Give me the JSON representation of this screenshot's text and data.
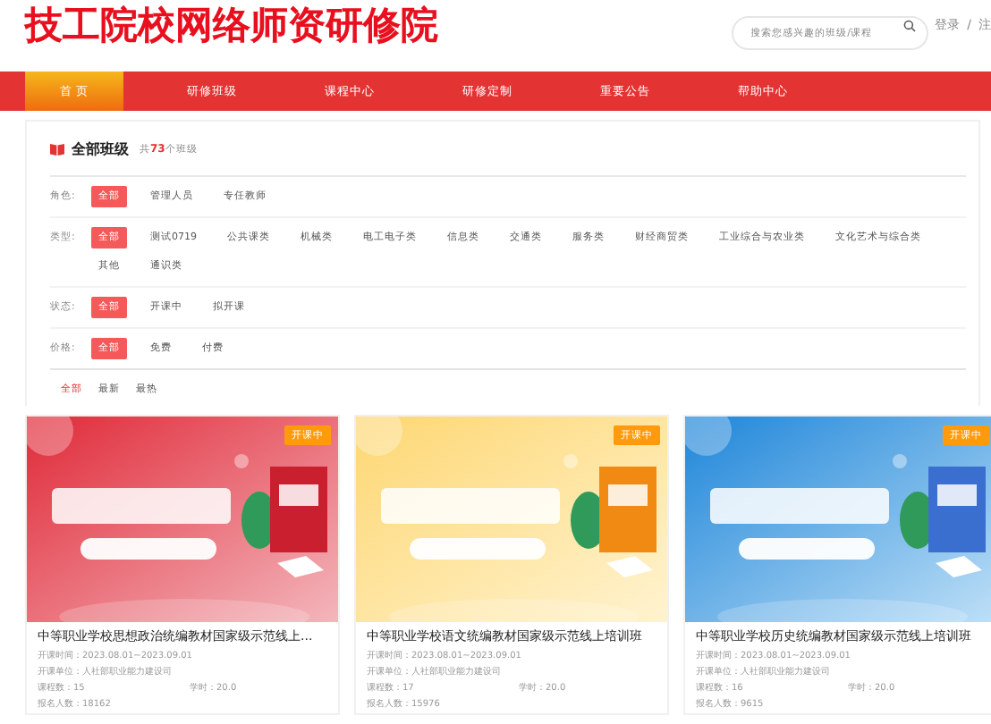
{
  "site": {
    "title": "技工院校网络师资研修院",
    "search_placeholder": "搜索您感兴趣的班级/课程",
    "login": "登录",
    "separator": "/",
    "register": "注"
  },
  "nav": [
    {
      "label": "首 页",
      "selected": true
    },
    {
      "label": "研修班级",
      "selected": false
    },
    {
      "label": "课程中心",
      "selected": false
    },
    {
      "label": "研修定制",
      "selected": false
    },
    {
      "label": "重要公告",
      "selected": false
    },
    {
      "label": "帮助中心",
      "selected": false
    }
  ],
  "filter": {
    "title": "全部班级",
    "count_prefix": "共",
    "count": "73",
    "count_suffix": "个班级",
    "groups": [
      {
        "label": "角色:",
        "options": [
          {
            "label": "全部",
            "selected": true
          },
          {
            "label": "管理人员",
            "selected": false
          },
          {
            "label": "专任教师",
            "selected": false
          }
        ]
      },
      {
        "label": "类型:",
        "options": [
          {
            "label": "全部",
            "selected": true
          },
          {
            "label": "测试0719",
            "selected": false
          },
          {
            "label": "公共课类",
            "selected": false
          },
          {
            "label": "机械类",
            "selected": false
          },
          {
            "label": "电工电子类",
            "selected": false
          },
          {
            "label": "信息类",
            "selected": false
          },
          {
            "label": "交通类",
            "selected": false
          },
          {
            "label": "服务类",
            "selected": false
          },
          {
            "label": "财经商贸类",
            "selected": false
          },
          {
            "label": "工业综合与农业类",
            "selected": false
          },
          {
            "label": "文化艺术与综合类",
            "selected": false
          },
          {
            "label": "其他",
            "selected": false
          },
          {
            "label": "通识类",
            "selected": false
          }
        ]
      },
      {
        "label": "状态:",
        "options": [
          {
            "label": "全部",
            "selected": true
          },
          {
            "label": "开课中",
            "selected": false
          },
          {
            "label": "拟开课",
            "selected": false
          }
        ]
      },
      {
        "label": "价格:",
        "options": [
          {
            "label": "全部",
            "selected": true
          },
          {
            "label": "免费",
            "selected": false
          },
          {
            "label": "付费",
            "selected": false
          }
        ]
      }
    ],
    "sort": [
      {
        "label": "全部",
        "selected": true
      },
      {
        "label": "最新",
        "selected": false
      },
      {
        "label": "最热",
        "selected": false
      }
    ]
  },
  "cards": [
    {
      "badge": "开课中",
      "title": "中等职业学校思想政治统编教材国家级示范线上...",
      "time_label": "开课时间：",
      "time": "2023.08.01~2023.09.01",
      "unit_label": "开课单位：",
      "unit": "人社部职业能力建设司",
      "lessons_label": "课程数：",
      "lessons": "15",
      "hours_label": "学时：",
      "hours": "20.0",
      "enrolled_label": "报名人数：",
      "enrolled": "18162"
    },
    {
      "badge": "开课中",
      "title": "中等职业学校语文统编教材国家级示范线上培训班",
      "time_label": "开课时间：",
      "time": "2023.08.01~2023.09.01",
      "unit_label": "开课单位：",
      "unit": "人社部职业能力建设司",
      "lessons_label": "课程数：",
      "lessons": "17",
      "hours_label": "学时：",
      "hours": "20.0",
      "enrolled_label": "报名人数：",
      "enrolled": "15976"
    },
    {
      "badge": "开课中",
      "title": "中等职业学校历史统编教材国家级示范线上培训班",
      "time_label": "开课时间：",
      "time": "2023.08.01~2023.09.01",
      "unit_label": "开课单位：",
      "unit": "人社部职业能力建设司",
      "lessons_label": "课程数：",
      "lessons": "16",
      "hours_label": "学时：",
      "hours": "20.0",
      "enrolled_label": "报名人数：",
      "enrolled": "9615"
    }
  ]
}
